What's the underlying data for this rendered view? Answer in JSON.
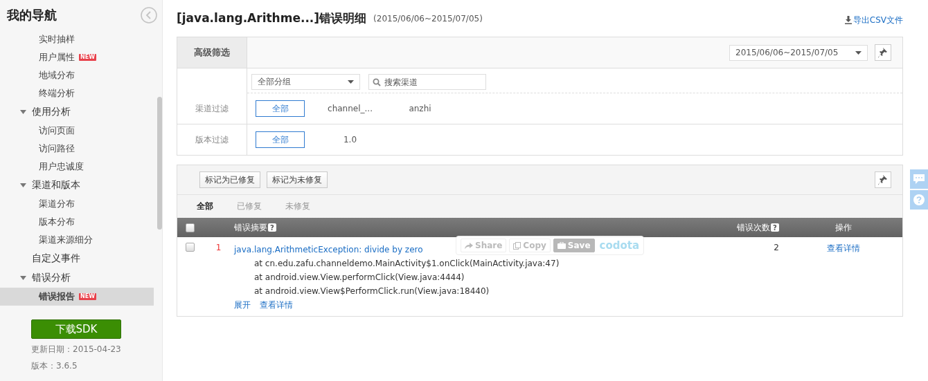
{
  "sidebar": {
    "title": "我的导航",
    "items": [
      {
        "kind": "page",
        "label": "实时抽样",
        "selected": false
      },
      {
        "kind": "page",
        "label": "用户属性",
        "badge": "NEW",
        "selected": false
      },
      {
        "kind": "page",
        "label": "地域分布",
        "selected": false
      },
      {
        "kind": "page",
        "label": "终端分析",
        "selected": false
      },
      {
        "kind": "group",
        "label": "使用分析",
        "expanded": true,
        "selected": false,
        "children": [
          {
            "kind": "page",
            "label": "访问页面",
            "selected": false
          },
          {
            "kind": "page",
            "label": "访问路径",
            "selected": false
          },
          {
            "kind": "page",
            "label": "用户忠诚度",
            "selected": false
          }
        ]
      },
      {
        "kind": "group",
        "label": "渠道和版本",
        "expanded": true,
        "selected": false,
        "children": [
          {
            "kind": "page",
            "label": "渠道分布",
            "selected": false
          },
          {
            "kind": "page",
            "label": "版本分布",
            "selected": false
          },
          {
            "kind": "page",
            "label": "渠道来源细分",
            "selected": false
          }
        ]
      },
      {
        "kind": "section",
        "label": "自定义事件",
        "selected": false
      },
      {
        "kind": "group",
        "label": "错误分析",
        "expanded": true,
        "selected": false,
        "children": [
          {
            "kind": "page",
            "label": "错误报告",
            "badge": "NEW",
            "selected": true
          }
        ]
      }
    ],
    "sdk_button": "下载SDK",
    "update_date": "更新日期：2015-04-23",
    "version": "版本：3.6.5"
  },
  "header": {
    "title": "[java.lang.Arithme...]错误明细",
    "date_range": "(2015/06/06~2015/07/05)",
    "export": "导出CSV文件"
  },
  "filter": {
    "tab": "高级筛选",
    "date_select": "2015/06/06~2015/07/05",
    "rows": [
      {
        "label": "渠道过滤",
        "group_select": "全部分组",
        "search_placeholder": "搜索渠道",
        "options": [
          {
            "label": "全部",
            "selected": true
          },
          {
            "label": "channel_...",
            "selected": false
          },
          {
            "label": "anzhi",
            "selected": false
          }
        ]
      },
      {
        "label": "版本过滤",
        "options": [
          {
            "label": "全部",
            "selected": true
          },
          {
            "label": "1.0",
            "selected": false
          }
        ]
      }
    ]
  },
  "errors": {
    "actions": [
      "标记为已修复",
      "标记为未修复"
    ],
    "tabs": [
      {
        "label": "全部",
        "selected": true
      },
      {
        "label": "已修复",
        "selected": false
      },
      {
        "label": "未修复",
        "selected": false
      }
    ],
    "select_all": {
      "checked": false
    },
    "columns": [
      {
        "label": "错误摘要",
        "help": "?"
      },
      {
        "label": "错误次数",
        "help": "?"
      },
      {
        "label": "操作"
      }
    ],
    "rows": [
      {
        "checked": false,
        "index": "1",
        "summary": "java.lang.ArithmeticException: divide by zero",
        "stack": [
          "at cn.edu.zafu.channeldemo.MainActivity$1.onClick(MainActivity.java:47)",
          "at android.view.View.performClick(View.java:4444)",
          "at android.view.View$PerformClick.run(View.java:18440)"
        ],
        "links": [
          "展开",
          "查看详情"
        ],
        "count": "2",
        "action": "查看详情"
      }
    ]
  },
  "codota": {
    "share": "Share",
    "copy": "Copy",
    "save": "Save",
    "brand": "codota"
  }
}
